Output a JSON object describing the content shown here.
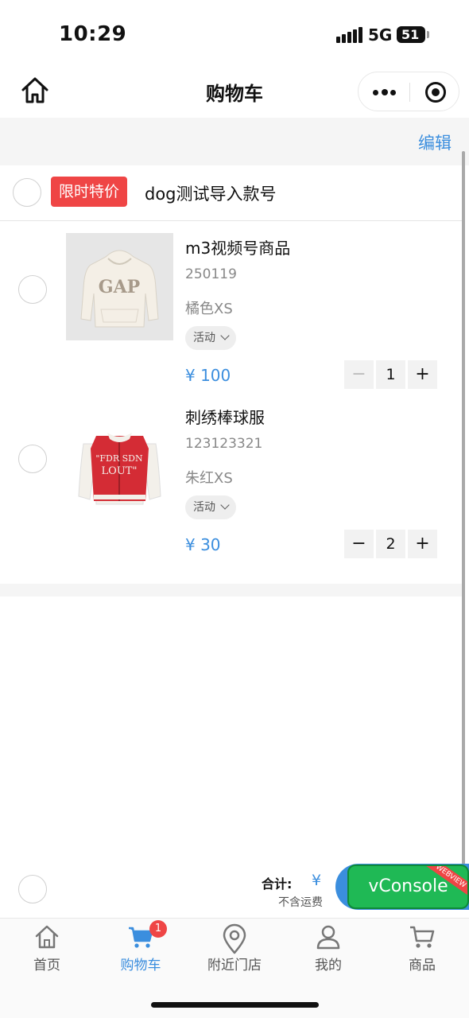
{
  "status_bar": {
    "time": "10:29",
    "network": "5G",
    "battery": "51"
  },
  "nav": {
    "title": "购物车"
  },
  "cart": {
    "edit_label": "编辑",
    "store": {
      "badge": "限时特价",
      "name": "dog测试导入款号"
    },
    "items": [
      {
        "title": "m3视频号商品",
        "code": "250119",
        "spec": "橘色XS",
        "promo": "活动",
        "price": "¥ 100",
        "qty": "1",
        "minus": "−",
        "plus": "+"
      },
      {
        "title": "刺绣棒球服",
        "code": "123123321",
        "spec": "朱红XS",
        "promo": "活动",
        "price": "¥ 30",
        "qty": "2",
        "minus": "−",
        "plus": "+"
      }
    ]
  },
  "checkout": {
    "total_label": "合计:",
    "currency": "¥",
    "note": "不含运费"
  },
  "vconsole": {
    "label": "vConsole",
    "ribbon": "WEBVIEW"
  },
  "tabbar": {
    "tabs": [
      {
        "label": "首页",
        "icon": "home-icon"
      },
      {
        "label": "购物车",
        "icon": "cart-icon",
        "badge": "1"
      },
      {
        "label": "附近门店",
        "icon": "location-pin-icon"
      },
      {
        "label": "我的",
        "icon": "user-icon"
      },
      {
        "label": "商品",
        "icon": "product-cart-icon"
      }
    ]
  },
  "colors": {
    "accent": "#3b8ede",
    "badge_red": "#ef4545",
    "vconsole_green": "#1fb955"
  }
}
